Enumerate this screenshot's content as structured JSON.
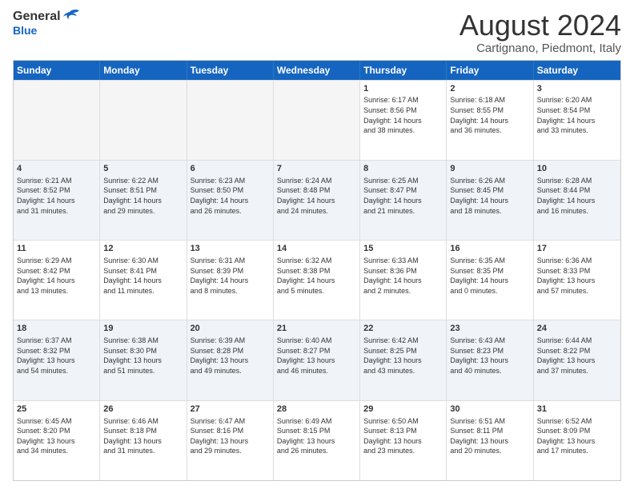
{
  "logo": {
    "general": "General",
    "blue": "Blue"
  },
  "title": "August 2024",
  "location": "Cartignano, Piedmont, Italy",
  "days": [
    "Sunday",
    "Monday",
    "Tuesday",
    "Wednesday",
    "Thursday",
    "Friday",
    "Saturday"
  ],
  "weeks": [
    [
      {
        "day": "",
        "text": "",
        "empty": true
      },
      {
        "day": "",
        "text": "",
        "empty": true
      },
      {
        "day": "",
        "text": "",
        "empty": true
      },
      {
        "day": "",
        "text": "",
        "empty": true
      },
      {
        "day": "1",
        "text": "Sunrise: 6:17 AM\nSunset: 8:56 PM\nDaylight: 14 hours\nand 38 minutes."
      },
      {
        "day": "2",
        "text": "Sunrise: 6:18 AM\nSunset: 8:55 PM\nDaylight: 14 hours\nand 36 minutes."
      },
      {
        "day": "3",
        "text": "Sunrise: 6:20 AM\nSunset: 8:54 PM\nDaylight: 14 hours\nand 33 minutes."
      }
    ],
    [
      {
        "day": "4",
        "text": "Sunrise: 6:21 AM\nSunset: 8:52 PM\nDaylight: 14 hours\nand 31 minutes."
      },
      {
        "day": "5",
        "text": "Sunrise: 6:22 AM\nSunset: 8:51 PM\nDaylight: 14 hours\nand 29 minutes."
      },
      {
        "day": "6",
        "text": "Sunrise: 6:23 AM\nSunset: 8:50 PM\nDaylight: 14 hours\nand 26 minutes."
      },
      {
        "day": "7",
        "text": "Sunrise: 6:24 AM\nSunset: 8:48 PM\nDaylight: 14 hours\nand 24 minutes."
      },
      {
        "day": "8",
        "text": "Sunrise: 6:25 AM\nSunset: 8:47 PM\nDaylight: 14 hours\nand 21 minutes."
      },
      {
        "day": "9",
        "text": "Sunrise: 6:26 AM\nSunset: 8:45 PM\nDaylight: 14 hours\nand 18 minutes."
      },
      {
        "day": "10",
        "text": "Sunrise: 6:28 AM\nSunset: 8:44 PM\nDaylight: 14 hours\nand 16 minutes."
      }
    ],
    [
      {
        "day": "11",
        "text": "Sunrise: 6:29 AM\nSunset: 8:42 PM\nDaylight: 14 hours\nand 13 minutes."
      },
      {
        "day": "12",
        "text": "Sunrise: 6:30 AM\nSunset: 8:41 PM\nDaylight: 14 hours\nand 11 minutes."
      },
      {
        "day": "13",
        "text": "Sunrise: 6:31 AM\nSunset: 8:39 PM\nDaylight: 14 hours\nand 8 minutes."
      },
      {
        "day": "14",
        "text": "Sunrise: 6:32 AM\nSunset: 8:38 PM\nDaylight: 14 hours\nand 5 minutes."
      },
      {
        "day": "15",
        "text": "Sunrise: 6:33 AM\nSunset: 8:36 PM\nDaylight: 14 hours\nand 2 minutes."
      },
      {
        "day": "16",
        "text": "Sunrise: 6:35 AM\nSunset: 8:35 PM\nDaylight: 14 hours\nand 0 minutes."
      },
      {
        "day": "17",
        "text": "Sunrise: 6:36 AM\nSunset: 8:33 PM\nDaylight: 13 hours\nand 57 minutes."
      }
    ],
    [
      {
        "day": "18",
        "text": "Sunrise: 6:37 AM\nSunset: 8:32 PM\nDaylight: 13 hours\nand 54 minutes."
      },
      {
        "day": "19",
        "text": "Sunrise: 6:38 AM\nSunset: 8:30 PM\nDaylight: 13 hours\nand 51 minutes."
      },
      {
        "day": "20",
        "text": "Sunrise: 6:39 AM\nSunset: 8:28 PM\nDaylight: 13 hours\nand 49 minutes."
      },
      {
        "day": "21",
        "text": "Sunrise: 6:40 AM\nSunset: 8:27 PM\nDaylight: 13 hours\nand 46 minutes."
      },
      {
        "day": "22",
        "text": "Sunrise: 6:42 AM\nSunset: 8:25 PM\nDaylight: 13 hours\nand 43 minutes."
      },
      {
        "day": "23",
        "text": "Sunrise: 6:43 AM\nSunset: 8:23 PM\nDaylight: 13 hours\nand 40 minutes."
      },
      {
        "day": "24",
        "text": "Sunrise: 6:44 AM\nSunset: 8:22 PM\nDaylight: 13 hours\nand 37 minutes."
      }
    ],
    [
      {
        "day": "25",
        "text": "Sunrise: 6:45 AM\nSunset: 8:20 PM\nDaylight: 13 hours\nand 34 minutes."
      },
      {
        "day": "26",
        "text": "Sunrise: 6:46 AM\nSunset: 8:18 PM\nDaylight: 13 hours\nand 31 minutes."
      },
      {
        "day": "27",
        "text": "Sunrise: 6:47 AM\nSunset: 8:16 PM\nDaylight: 13 hours\nand 29 minutes."
      },
      {
        "day": "28",
        "text": "Sunrise: 6:49 AM\nSunset: 8:15 PM\nDaylight: 13 hours\nand 26 minutes."
      },
      {
        "day": "29",
        "text": "Sunrise: 6:50 AM\nSunset: 8:13 PM\nDaylight: 13 hours\nand 23 minutes."
      },
      {
        "day": "30",
        "text": "Sunrise: 6:51 AM\nSunset: 8:11 PM\nDaylight: 13 hours\nand 20 minutes."
      },
      {
        "day": "31",
        "text": "Sunrise: 6:52 AM\nSunset: 8:09 PM\nDaylight: 13 hours\nand 17 minutes."
      }
    ]
  ]
}
